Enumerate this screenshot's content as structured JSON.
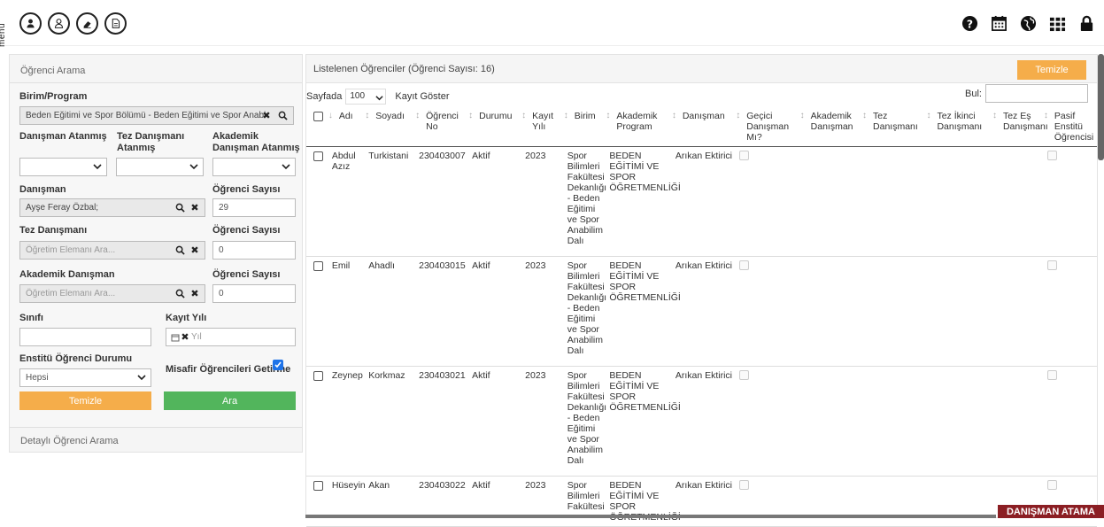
{
  "topbar": {
    "menu_label": "menü",
    "left_icons": [
      "user-filled-icon",
      "user-outline-icon",
      "eraser-icon",
      "document-icon"
    ],
    "right_icons": [
      "help-icon",
      "calendar-icon",
      "globe-icon",
      "grid-icon",
      "lock-icon"
    ]
  },
  "search_panel": {
    "title": "Öğrenci Arama",
    "birim_label": "Birim/Program",
    "birim_value": "Beden Eğitimi ve Spor Bölümü - Beden Eğitimi ve Spor Anabi",
    "danisman_atanmis_label": "Danışman Atanmış",
    "tez_danismani_atanmis_label": "Tez Danışmanı Atanmış",
    "akademik_danisman_atanmis_label": "Akademik Danışman Atanmış",
    "danisman_label": "Danışman",
    "danisman_value": "Ayşe Feray Özbal;",
    "ogrenci_sayisi_label": "Öğrenci Sayısı",
    "ogrenci_sayisi_1": "29",
    "tez_danismani_label": "Tez Danışmanı",
    "tez_placeholder": "Öğretim Elemanı Ara...",
    "ogrenci_sayisi_2": "0",
    "akademik_danisman_label": "Akademik Danışman",
    "akademik_placeholder": "Öğretim Elemanı Ara...",
    "ogrenci_sayisi_3": "0",
    "sinifi_label": "Sınıfı",
    "kayit_yili_label": "Kayıt Yılı",
    "kayit_yili_placeholder": "Yıl",
    "enstitu_durumu_label": "Enstitü Öğrenci Durumu",
    "enstitu_durumu_value": "Hepsi",
    "misafir_label": "Misafir Öğrencileri Getirme",
    "temizle_label": "Temizle",
    "ara_label": "Ara",
    "detayli_label": "Detaylı Öğrenci Arama"
  },
  "list_panel": {
    "title": "Listelenen Öğrenciler (Öğrenci Sayısı: 16)",
    "temizle_label": "Temizle",
    "sayfada_label": "Sayfada",
    "page_size": "100",
    "kayit_goster_label": "Kayıt Göster",
    "bul_label": "Bul:",
    "columns": [
      "Adı",
      "Soyadı",
      "Öğrenci No",
      "Durumu",
      "Kayıt Yılı",
      "Birim",
      "Akademik Program",
      "Danışman",
      "Geçici Danışman Mı?",
      "Akademik Danışman",
      "Tez Danışmanı",
      "Tez İkinci Danışmanı",
      "Tez Eş Danışmanı",
      "Pasif Enstitü Öğrencisi"
    ],
    "rows": [
      {
        "adi": "Abdul Azız",
        "soyadi": "Turkistani",
        "no": "230403007",
        "durum": "Aktif",
        "yil": "2023",
        "birim": "Spor Bilimleri Fakültesi Dekanlığı - Beden Eğitimi ve Spor Anabilim Dalı",
        "program": "BEDEN EĞİTİMİ VE SPOR ÖĞRETMENLİĞİ",
        "danisman": "Arıkan Ektirici"
      },
      {
        "adi": "Emil",
        "soyadi": "Ahadlı",
        "no": "230403015",
        "durum": "Aktif",
        "yil": "2023",
        "birim": "Spor Bilimleri Fakültesi Dekanlığı - Beden Eğitimi ve Spor Anabilim Dalı",
        "program": "BEDEN EĞİTİMİ VE SPOR ÖĞRETMENLİĞİ",
        "danisman": "Arıkan Ektirici"
      },
      {
        "adi": "Zeynep",
        "soyadi": "Korkmaz",
        "no": "230403021",
        "durum": "Aktif",
        "yil": "2023",
        "birim": "Spor Bilimleri Fakültesi Dekanlığı - Beden Eğitimi ve Spor Anabilim Dalı",
        "program": "BEDEN EĞİTİMİ VE SPOR ÖĞRETMENLİĞİ",
        "danisman": "Arıkan Ektirici"
      },
      {
        "adi": "Hüseyin",
        "soyadi": "Akan",
        "no": "230403022",
        "durum": "Aktif",
        "yil": "2023",
        "birim": "Spor Bilimleri Fakültesi",
        "program": "BEDEN EĞİTİMİ VE SPOR ÖĞRETMENLİĞİ",
        "danisman": "Arıkan Ektirici"
      }
    ]
  },
  "footer_badge": "DANIŞMAN ATAMA",
  "colors": {
    "orange": "#f5ad4a",
    "green": "#52b55c",
    "badge": "#8b1e23",
    "check_blue": "#1e73e8"
  }
}
